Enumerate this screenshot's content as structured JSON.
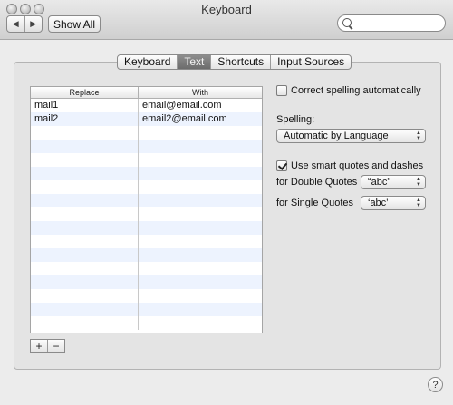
{
  "window": {
    "title": "Keyboard"
  },
  "toolbar": {
    "show_all_label": "Show All",
    "search_placeholder": "",
    "back_icon": "triangle-left",
    "forward_icon": "triangle-right"
  },
  "tabs": [
    {
      "label": "Keyboard",
      "active": false
    },
    {
      "label": "Text",
      "active": true
    },
    {
      "label": "Shortcuts",
      "active": false
    },
    {
      "label": "Input Sources",
      "active": false
    }
  ],
  "table": {
    "headers": [
      "Replace",
      "With"
    ],
    "rows": [
      [
        "mail1",
        "email@email.com"
      ],
      [
        "mail2",
        "email2@email.com"
      ],
      [
        "",
        ""
      ],
      [
        "",
        ""
      ],
      [
        "",
        ""
      ],
      [
        "",
        ""
      ],
      [
        "",
        ""
      ],
      [
        "",
        ""
      ],
      [
        "",
        ""
      ],
      [
        "",
        ""
      ],
      [
        "",
        ""
      ],
      [
        "",
        ""
      ],
      [
        "",
        ""
      ],
      [
        "",
        ""
      ],
      [
        "",
        ""
      ],
      [
        "",
        ""
      ],
      [
        "",
        ""
      ]
    ]
  },
  "table_buttons": {
    "add": "+",
    "remove": "−"
  },
  "options": {
    "correct_spelling_label": "Correct spelling automatically",
    "correct_spelling_checked": false,
    "spelling_label": "Spelling:",
    "spelling_value": "Automatic by Language",
    "smart_quotes_label": "Use smart quotes and dashes",
    "smart_quotes_checked": true,
    "double_quotes_label": "for Double Quotes",
    "double_quotes_value": "“abc”",
    "single_quotes_label": "for Single Quotes",
    "single_quotes_value": "‘abc’"
  },
  "help_label": "?",
  "colors": {
    "active_tab": "#7a7a7a",
    "row_alt": "#edf3fe"
  }
}
